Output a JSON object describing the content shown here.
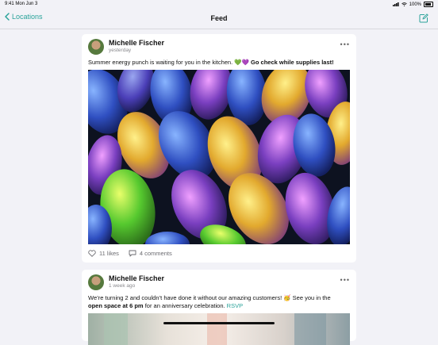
{
  "status_bar": {
    "time": "9:41 Mon Jun 3",
    "battery": "100%",
    "icons": [
      "signal-icon",
      "wifi-icon",
      "battery-icon"
    ]
  },
  "nav": {
    "back_label": "Locations",
    "title": "Feed",
    "compose_icon": "compose-icon"
  },
  "posts": [
    {
      "author": "Michelle Fischer",
      "time": "yesterday",
      "text_plain": "Summer energy punch is waiting for you in the kitchen. 💚💜 ",
      "text_bold": "Go check while supplies last!",
      "likes": "11 likes",
      "comments": "4 comments",
      "image": "figs-photo"
    },
    {
      "author": "Michelle Fischer",
      "time": "1 week ago",
      "text_part1": "We’re turning 2 and couldn’t have done it without our amazing customers! 🥳 See you in the",
      "text_bold": "open space at 6 pm",
      "text_part2": " for an anniversary celebration. ",
      "link": "RSVP",
      "image": "celebration-photo"
    }
  ],
  "colors": {
    "accent": "#2aa39a",
    "background": "#f2f2f7",
    "card": "#ffffff"
  }
}
